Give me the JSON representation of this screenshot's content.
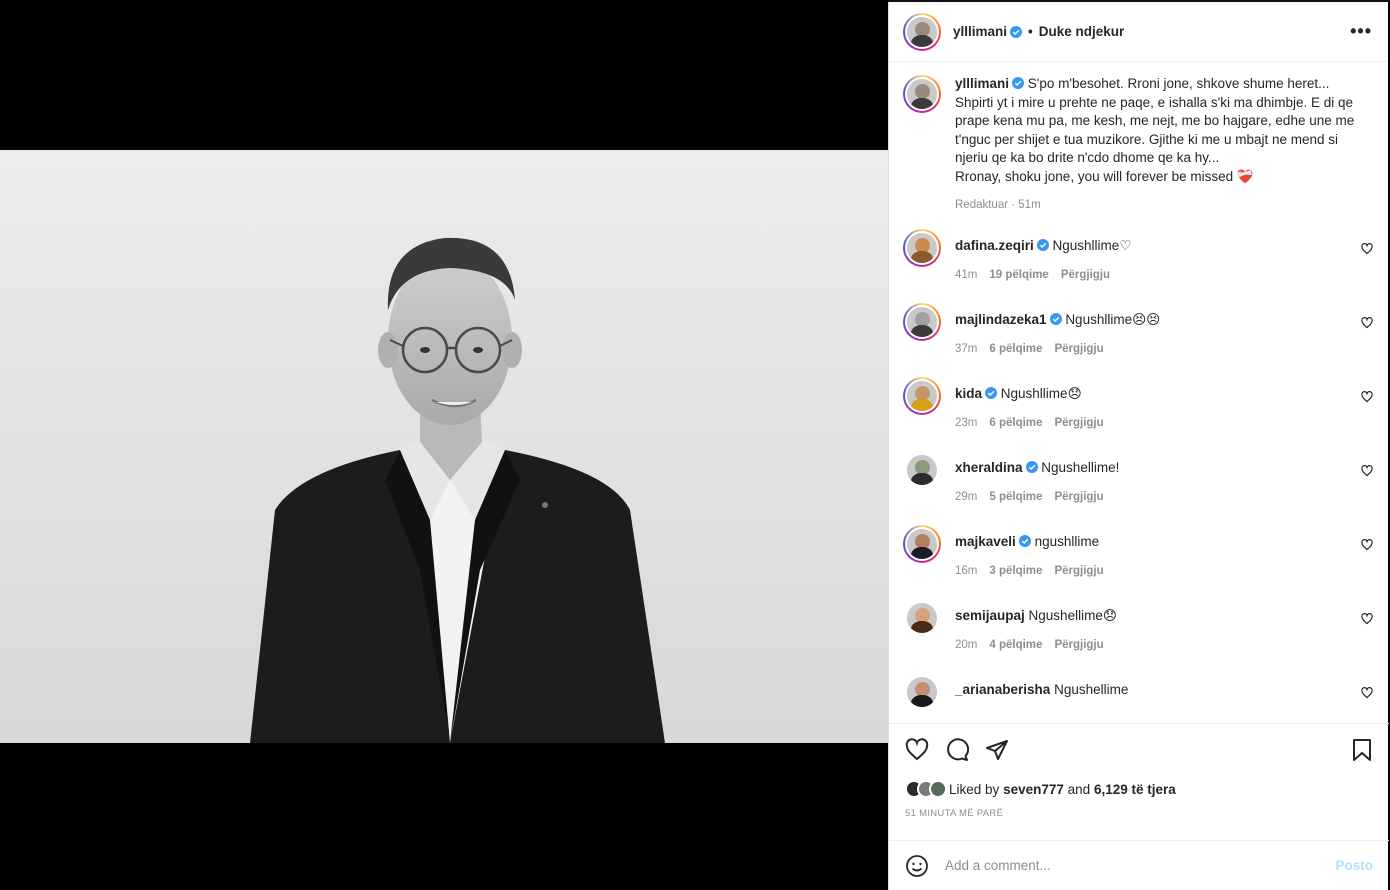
{
  "post": {
    "author": "ylllimani",
    "follow_status": "Duke ndjekur",
    "more_label": "•••",
    "caption": "S'po m'besohet. Rroni jone, shkove shume heret... Shpirti yt i mire u prehte ne paqe, e ishalla s'ki ma dhimbje. E di qe prape kena mu pa, me kesh, me nejt, me bo hajgare, edhe une me t'nguc per shijet e tua muzikore. Gjithe ki me u mbajt ne mend si njeriu qe ka bo drite n'cdo dhome qe ka hy...",
    "caption_line2": "Rronay, shoku jone, you will forever be missed",
    "caption_emoji": "❤️‍🩹",
    "caption_meta": "Redaktuar · 51m"
  },
  "comments": [
    {
      "user": "dafina.zeqiri",
      "verified": true,
      "text": "Ngushllime",
      "emoji": "♡",
      "time": "41m",
      "likes": "19 pëlqime",
      "reply": "Përgjigju",
      "colors": [
        "#c98a4b",
        "#8b5a2b"
      ]
    },
    {
      "user": "majlindazeka1",
      "verified": true,
      "text": "Ngushllime",
      "emoji": "😣😣",
      "time": "37m",
      "likes": "6 pëlqime",
      "reply": "Përgjigju",
      "colors": [
        "#a0a0a0",
        "#3a3a3a"
      ]
    },
    {
      "user": "kida",
      "verified": true,
      "text": "Ngushllime",
      "emoji": "😞",
      "time": "23m",
      "likes": "6 pëlqime",
      "reply": "Përgjigju",
      "colors": [
        "#c8946a",
        "#d4a017"
      ]
    },
    {
      "user": "xheraldina",
      "verified": true,
      "text": "Ngushellime!",
      "emoji": "",
      "time": "29m",
      "likes": "5 pëlqime",
      "reply": "Përgjigju",
      "colors": [
        "#8a9a7a",
        "#2a2a2a"
      ]
    },
    {
      "user": "majkaveli",
      "verified": true,
      "text": "ngushllime",
      "emoji": "",
      "time": "16m",
      "likes": "3 pëlqime",
      "reply": "Përgjigju",
      "colors": [
        "#b08060",
        "#1a1a2a"
      ]
    },
    {
      "user": "semijaupaj",
      "verified": false,
      "text": "Ngushellime",
      "emoji": "😞",
      "time": "20m",
      "likes": "4 pëlqime",
      "reply": "Përgjigju",
      "colors": [
        "#d9a080",
        "#4a2a1a"
      ]
    },
    {
      "user": "_arianaberisha",
      "verified": false,
      "text": "Ngushellime",
      "emoji": "",
      "time": "",
      "likes": "",
      "reply": "",
      "colors": [
        "#c09070",
        "#1a1a1a"
      ]
    }
  ],
  "likes": {
    "prefix": "Liked by",
    "user": "seven777",
    "and": "and",
    "others": "6,129 të tjera"
  },
  "timestamp": "51 MINUTA MË PARË",
  "add_comment": {
    "placeholder": "Add a comment...",
    "post_label": "Posto"
  },
  "icons": {
    "like": "heart-icon",
    "comment": "comment-icon",
    "share": "share-icon",
    "save": "bookmark-icon",
    "emoji": "emoji-icon",
    "verified": "verified-badge-icon"
  },
  "colors": {
    "verified": "#3897f0",
    "post_button": "#b2dffc",
    "muted": "#8e8e8e"
  }
}
